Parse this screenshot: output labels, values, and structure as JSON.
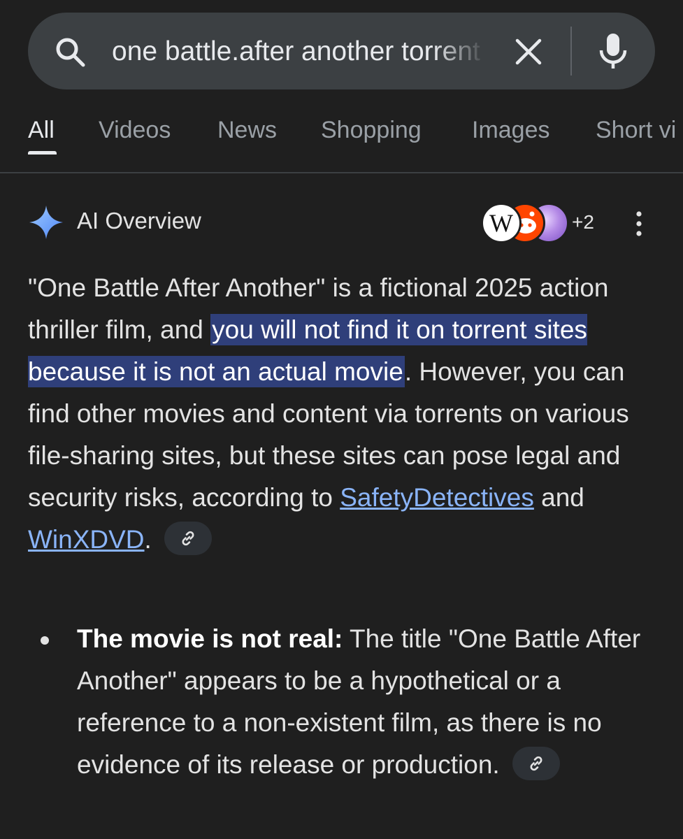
{
  "search": {
    "query": "one battle.after another torrent"
  },
  "tabs": [
    {
      "label": "All"
    },
    {
      "label": "Videos"
    },
    {
      "label": "News"
    },
    {
      "label": "Shopping"
    },
    {
      "label": "Images"
    },
    {
      "label": "Short vi"
    }
  ],
  "ai_overview": {
    "title": "AI Overview",
    "sources": {
      "avatars": [
        "wikipedia-icon",
        "reddit-icon",
        "purple-site-icon"
      ],
      "wiki_letter": "W",
      "more_count": "+2"
    },
    "paragraph": {
      "part1": "\"One Battle After Another\" is a fictional 2025 action thriller film, and ",
      "highlight": "you will not find it on torrent sites because it is not an actual movie",
      "part2": ". However, you can find other movies and content via torrents on various file-sharing sites, but these sites can pose legal and security risks, according to ",
      "link1": "SafetyDetectives",
      "and": " and ",
      "link2": "WinXDVD",
      "end": "."
    },
    "bullet": {
      "bold": "The movie is not real:",
      "text": " The title \"One Battle After Another\" appears to be a hypothetical or a reference to a non-existent film, as there is no evidence of its release or production."
    }
  },
  "colors": {
    "background": "#1f1f1f",
    "search_bar": "#3c4043",
    "highlight": "#2f3f7a",
    "link": "#8ab4f8"
  }
}
